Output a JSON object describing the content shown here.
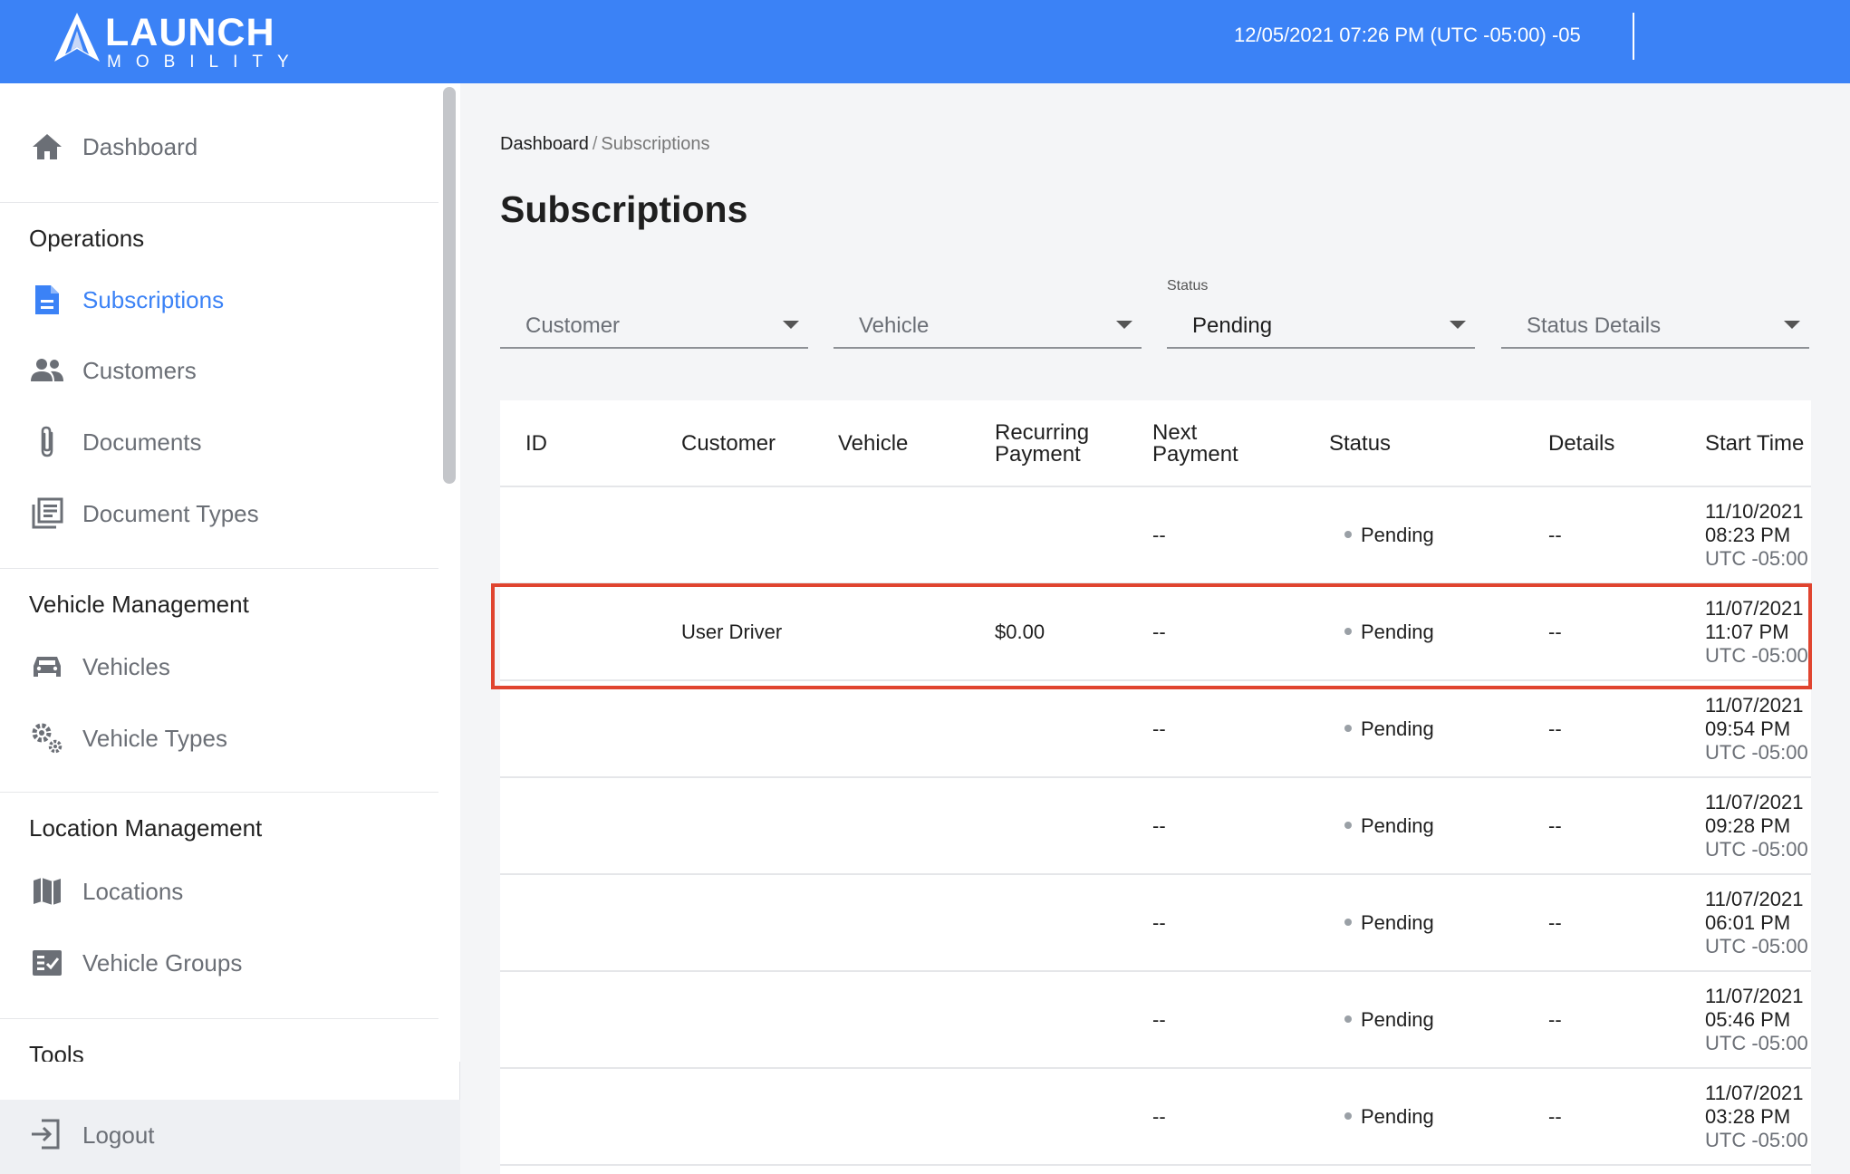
{
  "header": {
    "logo_title": "LAUNCH",
    "logo_subtitle": "MOBILITY",
    "datetime": "12/05/2021 07:26 PM (UTC -05:00) -05",
    "brand_color": "#3b82f6"
  },
  "sidebar": {
    "dashboard": {
      "label": "Dashboard",
      "icon": "home-icon"
    },
    "sections": [
      {
        "title": "Operations",
        "items": [
          {
            "label": "Subscriptions",
            "icon": "document-icon",
            "active": true
          },
          {
            "label": "Customers",
            "icon": "people-icon"
          },
          {
            "label": "Documents",
            "icon": "paperclip-icon"
          },
          {
            "label": "Document Types",
            "icon": "library-icon"
          }
        ]
      },
      {
        "title": "Vehicle Management",
        "items": [
          {
            "label": "Vehicles",
            "icon": "car-icon"
          },
          {
            "label": "Vehicle Types",
            "icon": "gears-icon"
          }
        ]
      },
      {
        "title": "Location Management",
        "items": [
          {
            "label": "Locations",
            "icon": "map-icon"
          },
          {
            "label": "Vehicle Groups",
            "icon": "checklist-icon"
          }
        ]
      },
      {
        "title": "Tools",
        "items": []
      }
    ],
    "logout": {
      "label": "Logout",
      "icon": "logout-icon"
    }
  },
  "breadcrumb": {
    "root": "Dashboard",
    "separator": "/",
    "current": "Subscriptions"
  },
  "page_title": "Subscriptions",
  "filters": [
    {
      "label": "",
      "value": "Customer",
      "placeholder": true
    },
    {
      "label": "",
      "value": "Vehicle",
      "placeholder": true
    },
    {
      "label": "Status",
      "value": "Pending",
      "placeholder": false
    },
    {
      "label": "",
      "value": "Status Details",
      "placeholder": true
    }
  ],
  "table": {
    "columns": [
      {
        "line1": "ID",
        "line2": ""
      },
      {
        "line1": "Customer",
        "line2": ""
      },
      {
        "line1": "Vehicle",
        "line2": ""
      },
      {
        "line1": "Recurring",
        "line2": "Payment"
      },
      {
        "line1": "Next",
        "line2": "Payment"
      },
      {
        "line1": "Status",
        "line2": ""
      },
      {
        "line1": "Details",
        "line2": ""
      },
      {
        "line1": "Start Time",
        "line2": ""
      }
    ],
    "rows": [
      {
        "id": "",
        "customer": "",
        "vehicle": "",
        "recurring": "",
        "next": "--",
        "status": "Pending",
        "details": "--",
        "date": "11/10/2021",
        "time": "08:23 PM",
        "tz": "UTC -05:00"
      },
      {
        "id": "",
        "customer": "User Driver",
        "vehicle": "",
        "recurring": "$0.00",
        "next": "--",
        "status": "Pending",
        "details": "--",
        "date": "11/07/2021",
        "time": "11:07 PM",
        "tz": "UTC -05:00",
        "highlighted": true
      },
      {
        "id": "",
        "customer": "",
        "vehicle": "",
        "recurring": "",
        "next": "--",
        "status": "Pending",
        "details": "--",
        "date": "11/07/2021",
        "time": "09:54 PM",
        "tz": "UTC -05:00"
      },
      {
        "id": "",
        "customer": "",
        "vehicle": "",
        "recurring": "",
        "next": "--",
        "status": "Pending",
        "details": "--",
        "date": "11/07/2021",
        "time": "09:28 PM",
        "tz": "UTC -05:00"
      },
      {
        "id": "",
        "customer": "",
        "vehicle": "",
        "recurring": "",
        "next": "--",
        "status": "Pending",
        "details": "--",
        "date": "11/07/2021",
        "time": "06:01 PM",
        "tz": "UTC -05:00"
      },
      {
        "id": "",
        "customer": "",
        "vehicle": "",
        "recurring": "",
        "next": "--",
        "status": "Pending",
        "details": "--",
        "date": "11/07/2021",
        "time": "05:46 PM",
        "tz": "UTC -05:00"
      },
      {
        "id": "",
        "customer": "",
        "vehicle": "",
        "recurring": "",
        "next": "--",
        "status": "Pending",
        "details": "--",
        "date": "11/07/2021",
        "time": "03:28 PM",
        "tz": "UTC -05:00"
      }
    ]
  },
  "highlight_color": "#e0442f"
}
